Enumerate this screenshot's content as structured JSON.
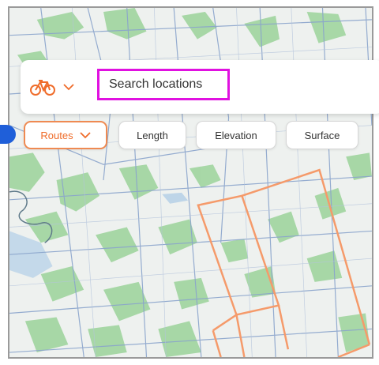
{
  "search": {
    "placeholder": "Search locations",
    "mode_icon": "bicycle-icon",
    "mode_dropdown_icon": "chevron-down-icon"
  },
  "filters": {
    "routes_label": "Routes",
    "length_label": "Length",
    "elevation_label": "Elevation",
    "surface_label": "Surface"
  },
  "colors": {
    "accent": "#ef6c2a",
    "route_line": "#f59a6a",
    "search_highlight": "#e011e0",
    "map_bg": "#eef1ef",
    "park_green": "#9bd39a",
    "road_blue": "#8aa4cc",
    "water_blue": "#a9c9e6"
  }
}
